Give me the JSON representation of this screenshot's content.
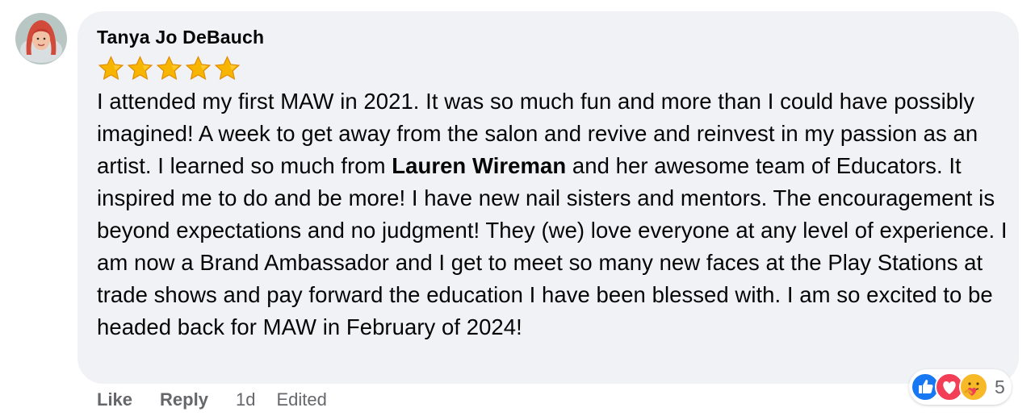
{
  "comment": {
    "author": "Tanya Jo DeBauch",
    "rating_stars": 5,
    "text_before_mention": "I attended my first MAW in 2021. It was so much fun and more than I could have possibly imagined! A week to get away from the salon and revive and reinvest in my passion as an artist. I learned so much from ",
    "mention": "Lauren Wireman",
    "text_after_mention": " and her awesome team of Educators. It inspired me to do and be more! I have new nail sisters and mentors. The encouragement is beyond expectations and no judgment! They (we) love everyone at any level of experience. I am now a Brand Ambassador and I get to meet so many new faces at the Play Stations at trade shows and pay forward the education I have been blessed with. I am so excited to be headed back for MAW in February of 2024!"
  },
  "actions": {
    "like_label": "Like",
    "reply_label": "Reply",
    "timestamp": "1d",
    "edited_label": "Edited"
  },
  "reactions": {
    "types": [
      "like-icon",
      "love-icon",
      "care-icon"
    ],
    "count": "5"
  },
  "colors": {
    "bubble_bg": "#f0f2f5",
    "text": "#050505",
    "secondary_text": "#65676b",
    "like_blue": "#1877f2",
    "love_red": "#f33e58",
    "star_gold": "#f7b500"
  }
}
